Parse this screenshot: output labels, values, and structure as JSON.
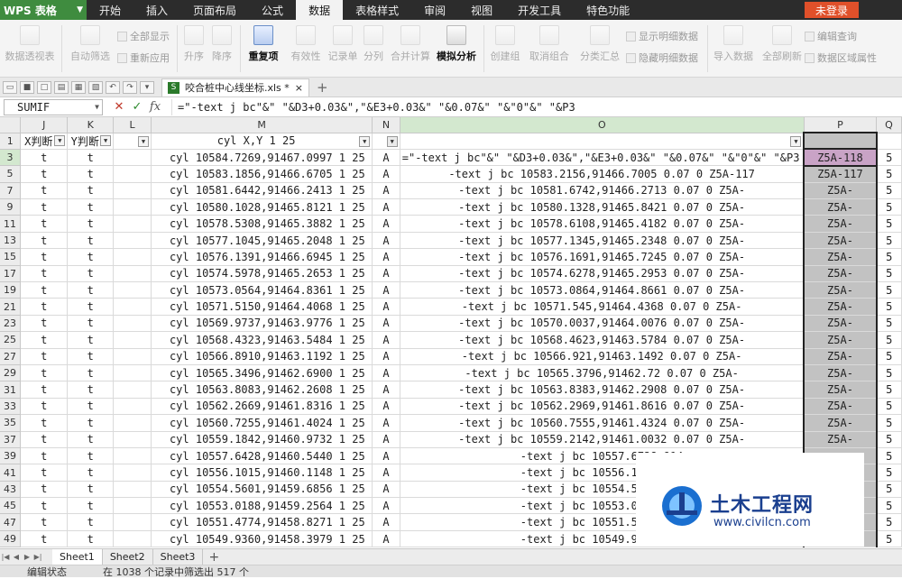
{
  "app": {
    "name": "WPS 表格",
    "login_label": "未登录"
  },
  "menu_tabs": [
    "开始",
    "插入",
    "页面布局",
    "公式",
    "数据",
    "表格样式",
    "审阅",
    "视图",
    "开发工具",
    "特色功能"
  ],
  "active_menu_index": 4,
  "ribbon": {
    "pivot": "数据透视表",
    "autofilter": "自动筛选",
    "show_all": "全部显示",
    "reapply": "重新应用",
    "sort_asc": "升序",
    "sort_desc": "降序",
    "duplicates": "重复项",
    "validation": "有效性",
    "record_sheet": "记录单",
    "split": "分列",
    "consolidate": "合并计算",
    "what_if": "模拟分析",
    "group": "创建组",
    "ungroup": "取消组合",
    "subtotal": "分类汇总",
    "show_detail": "显示明细数据",
    "hide_detail": "隐藏明细数据",
    "import": "导入数据",
    "refresh_all": "全部刷新",
    "edit_query": "编辑查询",
    "range_props": "数据区域属性"
  },
  "doc_tab": {
    "filename": "咬合桩中心线坐标.xls *",
    "close": "×",
    "add": "+"
  },
  "formula_bar": {
    "name_box": "SUMIF",
    "formula": "=\"-text j bc\"&\" \"&D3+0.03&\",\"&E3+0.03&\" \"&0.07&\" \"&\"0\"&\" \"&P3"
  },
  "columns": [
    "J",
    "K",
    "L",
    "M",
    "N",
    "O",
    "P",
    "Q"
  ],
  "filter_headers": [
    "X判断",
    "Y判断",
    "",
    "cyl X,Y 1 25",
    "",
    "",
    "",
    ""
  ],
  "edit_text": "=\"-text j bc\"&\" \"&D3+0.03&\",\"&E3+0.03&\" \"&0.07&\" \"&\"0\"&\" \"&P3",
  "rows": [
    {
      "row": "3",
      "j": "t",
      "k": "t",
      "m": "cyl 10584.7269,91467.0997 1 25",
      "n": "A",
      "o": "",
      "p": "Z5A-118",
      "q": "5"
    },
    {
      "row": "5",
      "j": "t",
      "k": "t",
      "m": "cyl 10583.1856,91466.6705 1 25",
      "n": "A",
      "o": "-text j bc 10583.2156,91466.7005 0.07 0 Z5A-117",
      "p": "Z5A-117",
      "q": "5"
    },
    {
      "row": "7",
      "j": "t",
      "k": "t",
      "m": "cyl 10581.6442,91466.2413 1 25",
      "n": "A",
      "o": "-text j bc 10581.6742,91466.2713 0.07 0 Z5A-",
      "p": "Z5A-",
      "q": "5"
    },
    {
      "row": "9",
      "j": "t",
      "k": "t",
      "m": "cyl 10580.1028,91465.8121 1 25",
      "n": "A",
      "o": "-text j bc 10580.1328,91465.8421 0.07 0 Z5A-",
      "p": "Z5A-",
      "q": "5"
    },
    {
      "row": "11",
      "j": "t",
      "k": "t",
      "m": "cyl 10578.5308,91465.3882 1 25",
      "n": "A",
      "o": "-text j bc 10578.6108,91465.4182 0.07 0 Z5A-",
      "p": "Z5A-",
      "q": "5"
    },
    {
      "row": "13",
      "j": "t",
      "k": "t",
      "m": "cyl 10577.1045,91465.2048 1 25",
      "n": "A",
      "o": "-text j bc 10577.1345,91465.2348 0.07 0 Z5A-",
      "p": "Z5A-",
      "q": "5"
    },
    {
      "row": "15",
      "j": "t",
      "k": "t",
      "m": "cyl 10576.1391,91466.6945 1 25",
      "n": "A",
      "o": "-text j bc 10576.1691,91465.7245 0.07 0 Z5A-",
      "p": "Z5A-",
      "q": "5"
    },
    {
      "row": "17",
      "j": "t",
      "k": "t",
      "m": "cyl 10574.5978,91465.2653 1 25",
      "n": "A",
      "o": "-text j bc 10574.6278,91465.2953 0.07 0 Z5A-",
      "p": "Z5A-",
      "q": "5"
    },
    {
      "row": "19",
      "j": "t",
      "k": "t",
      "m": "cyl 10573.0564,91464.8361 1 25",
      "n": "A",
      "o": "-text j bc 10573.0864,91464.8661 0.07 0 Z5A-",
      "p": "Z5A-",
      "q": "5"
    },
    {
      "row": "21",
      "j": "t",
      "k": "t",
      "m": "cyl 10571.5150,91464.4068 1 25",
      "n": "A",
      "o": "-text j bc 10571.545,91464.4368 0.07 0 Z5A-",
      "p": "Z5A-",
      "q": "5"
    },
    {
      "row": "23",
      "j": "t",
      "k": "t",
      "m": "cyl 10569.9737,91463.9776 1 25",
      "n": "A",
      "o": "-text j bc 10570.0037,91464.0076 0.07 0 Z5A-",
      "p": "Z5A-",
      "q": "5"
    },
    {
      "row": "25",
      "j": "t",
      "k": "t",
      "m": "cyl 10568.4323,91463.5484 1 25",
      "n": "A",
      "o": "-text j bc 10568.4623,91463.5784 0.07 0 Z5A-",
      "p": "Z5A-",
      "q": "5"
    },
    {
      "row": "27",
      "j": "t",
      "k": "t",
      "m": "cyl 10566.8910,91463.1192 1 25",
      "n": "A",
      "o": "-text j bc 10566.921,91463.1492 0.07 0 Z5A-",
      "p": "Z5A-",
      "q": "5"
    },
    {
      "row": "29",
      "j": "t",
      "k": "t",
      "m": "cyl 10565.3496,91462.6900 1 25",
      "n": "A",
      "o": "-text j bc 10565.3796,91462.72 0.07 0 Z5A-",
      "p": "Z5A-",
      "q": "5"
    },
    {
      "row": "31",
      "j": "t",
      "k": "t",
      "m": "cyl 10563.8083,91462.2608 1 25",
      "n": "A",
      "o": "-text j bc 10563.8383,91462.2908 0.07 0 Z5A-",
      "p": "Z5A-",
      "q": "5"
    },
    {
      "row": "33",
      "j": "t",
      "k": "t",
      "m": "cyl 10562.2669,91461.8316 1 25",
      "n": "A",
      "o": "-text j bc 10562.2969,91461.8616 0.07 0 Z5A-",
      "p": "Z5A-",
      "q": "5"
    },
    {
      "row": "35",
      "j": "t",
      "k": "t",
      "m": "cyl 10560.7255,91461.4024 1 25",
      "n": "A",
      "o": "-text j bc 10560.7555,91461.4324 0.07 0 Z5A-",
      "p": "Z5A-",
      "q": "5"
    },
    {
      "row": "37",
      "j": "t",
      "k": "t",
      "m": "cyl 10559.1842,91460.9732 1 25",
      "n": "A",
      "o": "-text j bc 10559.2142,91461.0032 0.07 0 Z5A-",
      "p": "Z5A-",
      "q": "5"
    },
    {
      "row": "39",
      "j": "t",
      "k": "t",
      "m": "cyl 10557.6428,91460.5440 1 25",
      "n": "A",
      "o": "-text j bc 10557.6728,914",
      "p": "",
      "q": "5"
    },
    {
      "row": "41",
      "j": "t",
      "k": "t",
      "m": "cyl 10556.1015,91460.1148 1 25",
      "n": "A",
      "o": "-text j bc 10556.1315,914",
      "p": "",
      "q": "5"
    },
    {
      "row": "43",
      "j": "t",
      "k": "t",
      "m": "cyl 10554.5601,91459.6856 1 25",
      "n": "A",
      "o": "-text j bc 10554.5901,914",
      "p": "",
      "q": "5"
    },
    {
      "row": "45",
      "j": "t",
      "k": "t",
      "m": "cyl 10553.0188,91459.2564 1 25",
      "n": "A",
      "o": "-text j bc 10553.0488,914",
      "p": "",
      "q": "5"
    },
    {
      "row": "47",
      "j": "t",
      "k": "t",
      "m": "cyl 10551.4774,91458.8271 1 25",
      "n": "A",
      "o": "-text j bc 10551.5074,914",
      "p": "",
      "q": "5"
    },
    {
      "row": "49",
      "j": "t",
      "k": "t",
      "m": "cyl 10549.9360,91458.3979 1 25",
      "n": "A",
      "o": "-text j bc 10549.966,9145",
      "p": "",
      "q": "5"
    }
  ],
  "sheets": [
    "Sheet1",
    "Sheet2",
    "Sheet3"
  ],
  "add_sheet": "+",
  "status": {
    "mode": "编辑状态",
    "filter_info": "在 1038 个记录中筛选出 517 个"
  },
  "watermark": {
    "cn": "土木工程网",
    "url": "www.civilcn.com"
  },
  "colors": {
    "app_green": "#3f8c3f",
    "login_orange": "#e0502a",
    "selected_cell": "#c9a3c6",
    "watermark_blue": "#1a3f8f"
  }
}
